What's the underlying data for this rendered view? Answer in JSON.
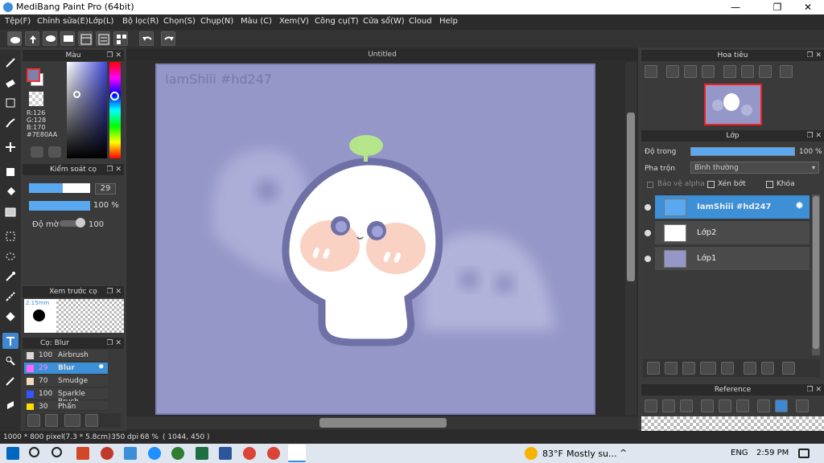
{
  "window": {
    "title": "MediBang Paint Pro (64bit)",
    "min": "—",
    "max": "❐",
    "close": "✕"
  },
  "menu": [
    "Tệp(F)",
    "Chỉnh sửa(E)",
    "Lớp(L)",
    "Bộ lọc(R)",
    "Chọn(S)",
    "Chụp(N)",
    "Màu (C)",
    "Xem(V)",
    "Công cụ(T)",
    "Cửa sổ(W)",
    "Cloud",
    "Help"
  ],
  "color_panel": {
    "title": "Màu",
    "r": "R:126",
    "g": "G:128",
    "b": "B:170",
    "hex": "#7E80AA",
    "fg_color": "#7e80aa"
  },
  "brush_control": {
    "title": "Kiểm soát cọ",
    "size": "29",
    "opacity": "100 %",
    "blur_label": "Độ mờ",
    "blur_value": "100"
  },
  "brush_preview": {
    "title": "Xem trước cọ",
    "size": "2.15mm"
  },
  "brush_list": {
    "title": "Cọ: Blur",
    "items": [
      {
        "size": "100",
        "name": "Airbrush",
        "color": "#d8d8d8"
      },
      {
        "size": "29",
        "name": "Blur",
        "color": "#ff66ff"
      },
      {
        "size": "70",
        "name": "Smudge",
        "color": "#f5d8c0"
      },
      {
        "size": "100",
        "name": "Sparkle Brush",
        "color": "#3355ff"
      },
      {
        "size": "30",
        "name": "Phấn",
        "color": "#ffdd00"
      }
    ]
  },
  "document": {
    "tab": "Untitled",
    "watermark": "IamShiii #hd247"
  },
  "navigator": {
    "title": "Hoa tiêu"
  },
  "layers": {
    "title": "Lớp",
    "opacity_label": "Độ trong",
    "opacity_value": "100 %",
    "blend_label": "Pha trộn",
    "blend_value": "Bình thường",
    "protect_alpha": "Bảo vệ alpha",
    "clipping": "Xén bớt",
    "lock": "Khóa",
    "items": [
      {
        "name": "IamShiii #hd247"
      },
      {
        "name": "Lớp2"
      },
      {
        "name": "Lớp1"
      }
    ]
  },
  "reference": {
    "title": "Reference"
  },
  "status": {
    "size": "1000 * 800 pixel",
    "dims": "(7.3 * 5.8cm)",
    "dpi": "350 dpi",
    "zoom": "68 %",
    "cursor": "( 1044, 450 )"
  },
  "taskbar": {
    "weather": "83°F",
    "weather_text": "Mostly su...",
    "lang": "ENG",
    "time": "2:59 PM"
  }
}
